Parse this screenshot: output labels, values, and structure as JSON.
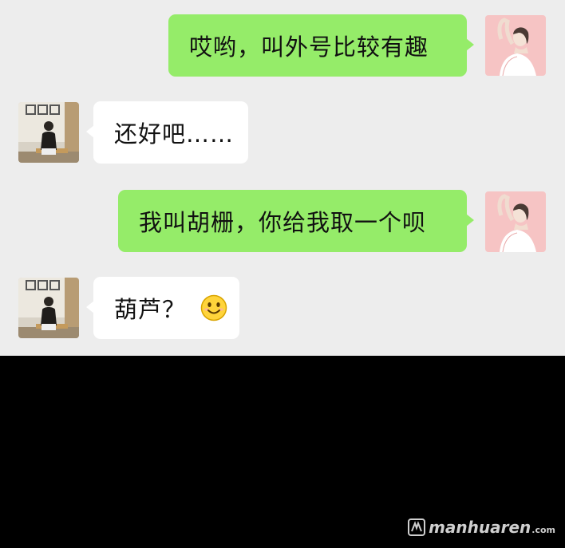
{
  "messages": [
    {
      "side": "out",
      "text": "哎哟，叫外号比较有趣"
    },
    {
      "side": "in",
      "text": "还好吧……"
    },
    {
      "side": "out",
      "text": "我叫胡栅，你给我取一个呗"
    },
    {
      "side": "in",
      "text": "葫芦？"
    }
  ],
  "emoji_icon": "smile-emoji-icon",
  "watermark": {
    "brand": "manhuaren",
    "suffix": ".com"
  },
  "colors": {
    "chat_background": "#ededed",
    "outgoing_bubble": "#95ec69",
    "incoming_bubble": "#ffffff",
    "letterbox": "#000000"
  }
}
